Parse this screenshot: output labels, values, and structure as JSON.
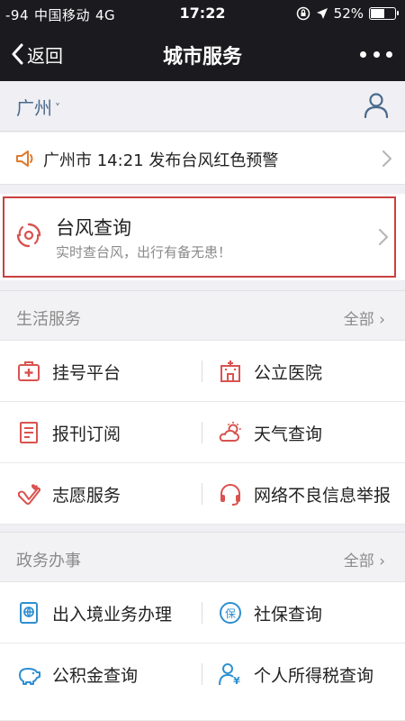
{
  "status_bar": {
    "signal": "-94",
    "carrier": "中国移动",
    "network": "4G",
    "time": "17:22",
    "battery": "52%",
    "battery_level": 0.52
  },
  "nav": {
    "back_label": "返回",
    "title": "城市服务"
  },
  "city": {
    "name": "广州",
    "caret": "˅"
  },
  "alert": {
    "text": "广州市 14:21 发布台风红色预警"
  },
  "featured": {
    "title": "台风查询",
    "subtitle": "实时查台风，出行有备无患！",
    "highlight_color": "#c9403f"
  },
  "sections": [
    {
      "title": "生活服务",
      "all_label": "全部",
      "rows": [
        [
          {
            "label": "挂号平台",
            "icon": "medical-kit-icon"
          },
          {
            "label": "公立医院",
            "icon": "hospital-icon"
          }
        ],
        [
          {
            "label": "报刊订阅",
            "icon": "newspaper-icon"
          },
          {
            "label": "天气查询",
            "icon": "weather-icon"
          }
        ],
        [
          {
            "label": "志愿服务",
            "icon": "heart-hand-icon"
          },
          {
            "label": "网络不良信息举报",
            "icon": "headset-icon"
          }
        ]
      ]
    },
    {
      "title": "政务办事",
      "all_label": "全部",
      "rows": [
        [
          {
            "label": "出入境业务办理",
            "icon": "passport-icon"
          },
          {
            "label": "社保查询",
            "icon": "social-security-icon"
          }
        ],
        [
          {
            "label": "公积金查询",
            "icon": "piggy-bank-icon"
          },
          {
            "label": "个人所得税查询",
            "icon": "tax-person-icon"
          }
        ]
      ]
    }
  ],
  "colors": {
    "life_icon": "#d9534f",
    "gov_icon": "#2f8fd0",
    "city_text": "#4a6a8c",
    "alert_icon": "#e07a2e"
  }
}
